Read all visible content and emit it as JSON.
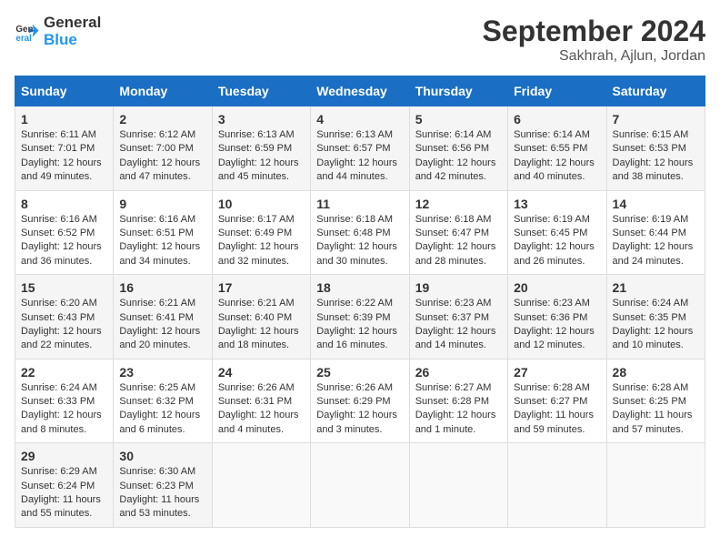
{
  "logo": {
    "line1": "General",
    "line2": "Blue"
  },
  "title": "September 2024",
  "location": "Sakhrah, Ajlun, Jordan",
  "weekdays": [
    "Sunday",
    "Monday",
    "Tuesday",
    "Wednesday",
    "Thursday",
    "Friday",
    "Saturday"
  ],
  "weeks": [
    [
      {
        "day": "1",
        "sunrise": "6:11 AM",
        "sunset": "7:01 PM",
        "daylight": "12 hours and 49 minutes."
      },
      {
        "day": "2",
        "sunrise": "6:12 AM",
        "sunset": "7:00 PM",
        "daylight": "12 hours and 47 minutes."
      },
      {
        "day": "3",
        "sunrise": "6:13 AM",
        "sunset": "6:59 PM",
        "daylight": "12 hours and 45 minutes."
      },
      {
        "day": "4",
        "sunrise": "6:13 AM",
        "sunset": "6:57 PM",
        "daylight": "12 hours and 44 minutes."
      },
      {
        "day": "5",
        "sunrise": "6:14 AM",
        "sunset": "6:56 PM",
        "daylight": "12 hours and 42 minutes."
      },
      {
        "day": "6",
        "sunrise": "6:14 AM",
        "sunset": "6:55 PM",
        "daylight": "12 hours and 40 minutes."
      },
      {
        "day": "7",
        "sunrise": "6:15 AM",
        "sunset": "6:53 PM",
        "daylight": "12 hours and 38 minutes."
      }
    ],
    [
      {
        "day": "8",
        "sunrise": "6:16 AM",
        "sunset": "6:52 PM",
        "daylight": "12 hours and 36 minutes."
      },
      {
        "day": "9",
        "sunrise": "6:16 AM",
        "sunset": "6:51 PM",
        "daylight": "12 hours and 34 minutes."
      },
      {
        "day": "10",
        "sunrise": "6:17 AM",
        "sunset": "6:49 PM",
        "daylight": "12 hours and 32 minutes."
      },
      {
        "day": "11",
        "sunrise": "6:18 AM",
        "sunset": "6:48 PM",
        "daylight": "12 hours and 30 minutes."
      },
      {
        "day": "12",
        "sunrise": "6:18 AM",
        "sunset": "6:47 PM",
        "daylight": "12 hours and 28 minutes."
      },
      {
        "day": "13",
        "sunrise": "6:19 AM",
        "sunset": "6:45 PM",
        "daylight": "12 hours and 26 minutes."
      },
      {
        "day": "14",
        "sunrise": "6:19 AM",
        "sunset": "6:44 PM",
        "daylight": "12 hours and 24 minutes."
      }
    ],
    [
      {
        "day": "15",
        "sunrise": "6:20 AM",
        "sunset": "6:43 PM",
        "daylight": "12 hours and 22 minutes."
      },
      {
        "day": "16",
        "sunrise": "6:21 AM",
        "sunset": "6:41 PM",
        "daylight": "12 hours and 20 minutes."
      },
      {
        "day": "17",
        "sunrise": "6:21 AM",
        "sunset": "6:40 PM",
        "daylight": "12 hours and 18 minutes."
      },
      {
        "day": "18",
        "sunrise": "6:22 AM",
        "sunset": "6:39 PM",
        "daylight": "12 hours and 16 minutes."
      },
      {
        "day": "19",
        "sunrise": "6:23 AM",
        "sunset": "6:37 PM",
        "daylight": "12 hours and 14 minutes."
      },
      {
        "day": "20",
        "sunrise": "6:23 AM",
        "sunset": "6:36 PM",
        "daylight": "12 hours and 12 minutes."
      },
      {
        "day": "21",
        "sunrise": "6:24 AM",
        "sunset": "6:35 PM",
        "daylight": "12 hours and 10 minutes."
      }
    ],
    [
      {
        "day": "22",
        "sunrise": "6:24 AM",
        "sunset": "6:33 PM",
        "daylight": "12 hours and 8 minutes."
      },
      {
        "day": "23",
        "sunrise": "6:25 AM",
        "sunset": "6:32 PM",
        "daylight": "12 hours and 6 minutes."
      },
      {
        "day": "24",
        "sunrise": "6:26 AM",
        "sunset": "6:31 PM",
        "daylight": "12 hours and 4 minutes."
      },
      {
        "day": "25",
        "sunrise": "6:26 AM",
        "sunset": "6:29 PM",
        "daylight": "12 hours and 3 minutes."
      },
      {
        "day": "26",
        "sunrise": "6:27 AM",
        "sunset": "6:28 PM",
        "daylight": "12 hours and 1 minute."
      },
      {
        "day": "27",
        "sunrise": "6:28 AM",
        "sunset": "6:27 PM",
        "daylight": "11 hours and 59 minutes."
      },
      {
        "day": "28",
        "sunrise": "6:28 AM",
        "sunset": "6:25 PM",
        "daylight": "11 hours and 57 minutes."
      }
    ],
    [
      {
        "day": "29",
        "sunrise": "6:29 AM",
        "sunset": "6:24 PM",
        "daylight": "11 hours and 55 minutes."
      },
      {
        "day": "30",
        "sunrise": "6:30 AM",
        "sunset": "6:23 PM",
        "daylight": "11 hours and 53 minutes."
      },
      null,
      null,
      null,
      null,
      null
    ]
  ]
}
